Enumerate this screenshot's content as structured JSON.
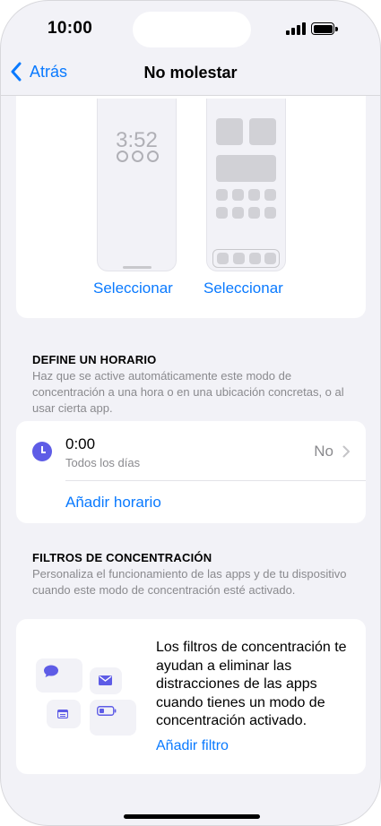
{
  "status_bar": {
    "time": "10:00"
  },
  "nav": {
    "back_label": "Atrás",
    "title": "No molestar"
  },
  "screens": {
    "lock_time": "3:52",
    "select_lock_label": "Seleccionar",
    "select_home_label": "Seleccionar"
  },
  "schedule_section": {
    "header": "DEFINE UN HORARIO",
    "description": "Haz que se active automáticamente este modo de concentración a una hora o en una ubicación concretas, o al usar cierta app.",
    "item": {
      "time": "0:00",
      "days": "Todos los días",
      "value": "No"
    },
    "add_label": "Añadir horario"
  },
  "filters_section": {
    "header": "FILTROS DE CONCENTRACIÓN",
    "description": "Personaliza el funcionamiento de las apps y de tu dispositivo cuando este modo de concentración esté activado.",
    "body": "Los filtros de concentración te ayudan a eliminar las distracciones de las apps cuando tienes un modo de concentración activado.",
    "add_label": "Añadir filtro"
  },
  "colors": {
    "accent": "#0a7aff",
    "schedule_icon": "#5e5ce6",
    "background": "#f2f2f7"
  }
}
